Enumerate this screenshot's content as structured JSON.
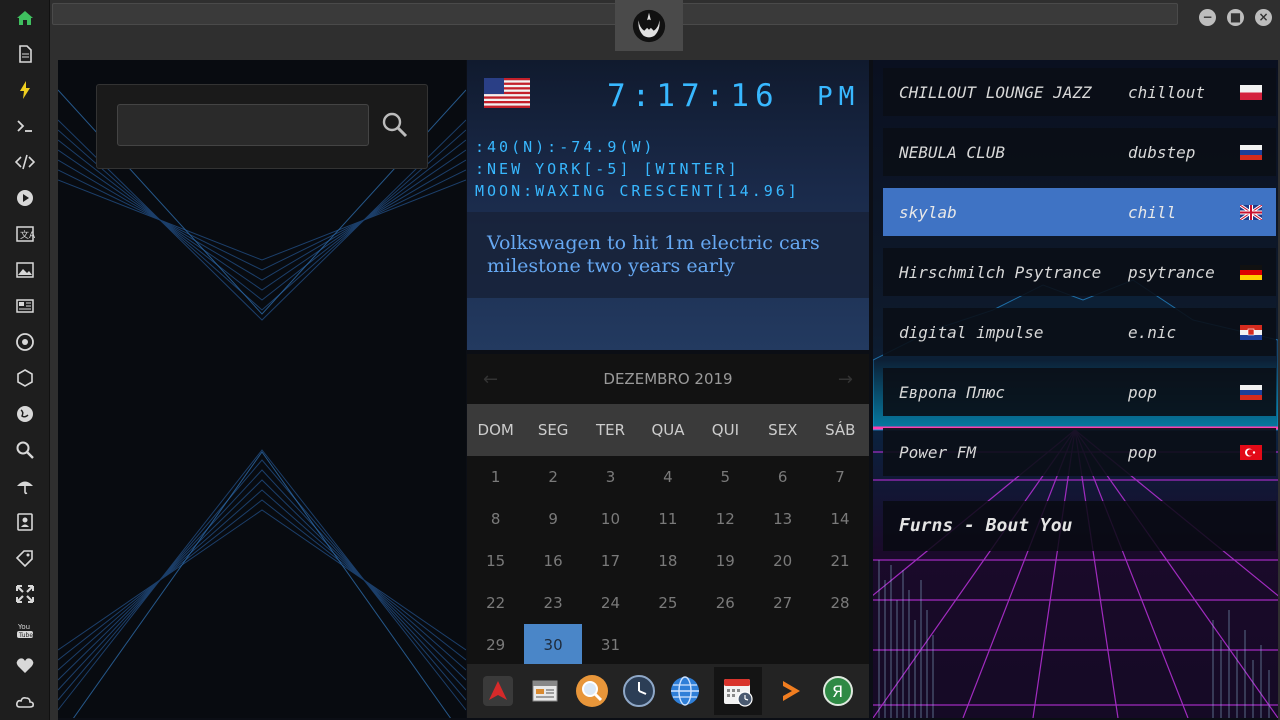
{
  "leftbar": {
    "icons": [
      "home-icon",
      "document-icon",
      "lightning-icon",
      "terminal-icon",
      "code-icon",
      "play-icon",
      "translate-icon",
      "image-icon",
      "news-icon",
      "rebel-icon",
      "hexagon-icon",
      "globe-icon",
      "search-icon",
      "umbrella-icon",
      "contacts-icon",
      "tag-icon",
      "expand-icon",
      "youtube-icon",
      "heart-icon",
      "cloud-icon"
    ]
  },
  "clock": {
    "time": "7:17:16",
    "ampm": "PM",
    "coords": ":40(N):-74.9(W)",
    "zone": ":NEW YORK[-5] [WINTER]",
    "moon": "MOON:WAXING CRESCENT[14.96]"
  },
  "news": {
    "headline": "Volkswagen to hit 1m electric cars milestone two years early"
  },
  "calendar": {
    "month": "DEZEMBRO 2019",
    "prev": "←",
    "next": "→",
    "day_names": [
      "DOM",
      "SEG",
      "TER",
      "QUA",
      "QUI",
      "SEX",
      "SÁB"
    ],
    "weeks": [
      [
        "1",
        "2",
        "3",
        "4",
        "5",
        "6",
        "7"
      ],
      [
        "8",
        "9",
        "10",
        "11",
        "12",
        "13",
        "14"
      ],
      [
        "15",
        "16",
        "17",
        "18",
        "19",
        "20",
        "21"
      ],
      [
        "22",
        "23",
        "24",
        "25",
        "26",
        "27",
        "28"
      ],
      [
        "29",
        "30",
        "31",
        "",
        "",
        "",
        ""
      ]
    ],
    "selected": "30"
  },
  "dock": {
    "icons": [
      "arrow-app-icon",
      "calendar-grid-icon",
      "search-app-icon",
      "clock-app-icon",
      "globe-app-icon",
      "calendar-app-icon",
      "play-arrow-icon",
      "yandex-icon"
    ]
  },
  "radio": {
    "stations": [
      {
        "name": "CHILLOUT LOUNGE JAZZ",
        "genre": "chillout",
        "flag": "poland"
      },
      {
        "name": "NEBULA CLUB",
        "genre": "dubstep",
        "flag": "russia"
      },
      {
        "name": "skylab",
        "genre": "chill",
        "flag": "uk"
      },
      {
        "name": "Hirschmilch Psytrance",
        "genre": "psytrance",
        "flag": "germany"
      },
      {
        "name": "digital impulse",
        "genre": "e.nic",
        "flag": "croatia"
      },
      {
        "name": "Европа Плюс",
        "genre": "pop",
        "flag": "russia"
      },
      {
        "name": "Power FM",
        "genre": "pop",
        "flag": "turkey"
      }
    ],
    "now_playing": "Furns - Bout You"
  },
  "colors": {
    "accent": "#4a86c8",
    "lcd": "#38b8ff",
    "news": "#66a8f2"
  }
}
